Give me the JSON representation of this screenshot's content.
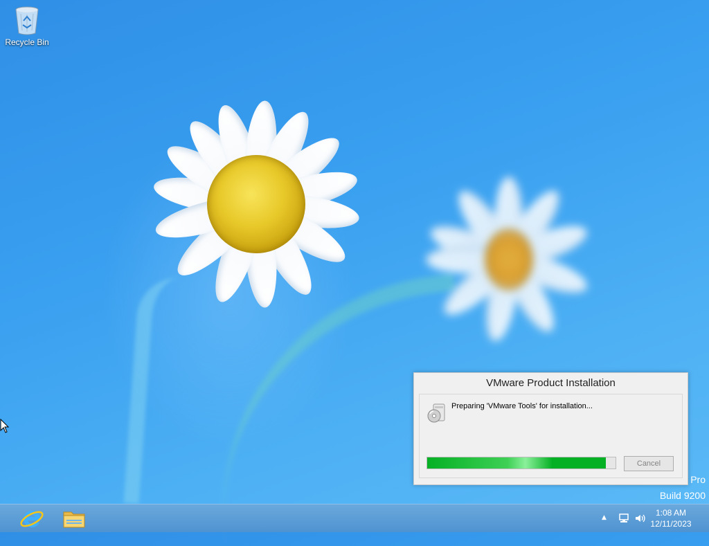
{
  "desktop": {
    "icons": [
      {
        "label": "Recycle Bin",
        "icon": "recycle-bin-icon"
      }
    ],
    "watermark": {
      "line1": "Pro",
      "line2": "Build 9200"
    }
  },
  "dialog": {
    "title": "VMware Product Installation",
    "status": "Preparing 'VMware Tools' for installation...",
    "progress_fraction": 0.95,
    "cancel_label": "Cancel",
    "cancel_enabled": false
  },
  "taskbar": {
    "pinned": [
      {
        "name": "Internet Explorer",
        "icon": "internet-explorer-icon"
      },
      {
        "name": "File Explorer",
        "icon": "file-explorer-icon"
      }
    ],
    "tray": {
      "icons": [
        "show-hidden-icons-arrow",
        "network-icon",
        "volume-icon"
      ],
      "time": "1:08 AM",
      "date": "12/11/2023"
    }
  },
  "colors": {
    "desktop_blue": "#3aa0f0",
    "taskbar": "#5b9bd5",
    "progress_green": "#06b025"
  }
}
